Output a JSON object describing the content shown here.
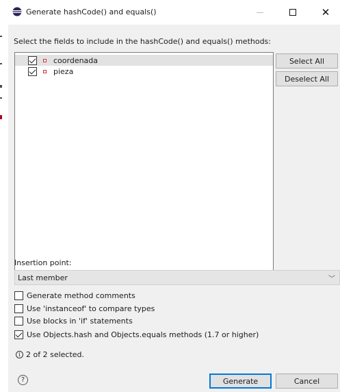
{
  "window": {
    "title": "Generate hashCode() and equals()"
  },
  "instructions": "Select the fields to include in the hashCode() and equals() methods:",
  "fields": [
    {
      "label": "coordenada",
      "checked": true,
      "selected": true
    },
    {
      "label": "pieza",
      "checked": true,
      "selected": false
    }
  ],
  "side_buttons": {
    "select_all": "Select All",
    "deselect_all": "Deselect All"
  },
  "insertion": {
    "label": "Insertion point:",
    "value": "Last member"
  },
  "options": [
    {
      "label": "Generate method comments",
      "checked": false
    },
    {
      "label": "Use 'instanceof' to compare types",
      "checked": false
    },
    {
      "label": "Use blocks in 'if' statements",
      "checked": false
    },
    {
      "label": "Use Objects.hash and Objects.equals methods (1.7 or higher)",
      "checked": true
    }
  ],
  "status": "2 of 2 selected.",
  "buttons": {
    "generate": "Generate",
    "cancel": "Cancel"
  },
  "colors": {
    "accent": "#0078d7",
    "field_icon": "#d32f2f",
    "app_icon": "#2c2255"
  }
}
